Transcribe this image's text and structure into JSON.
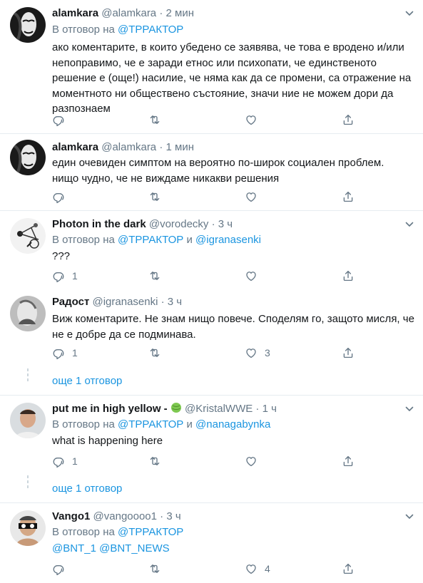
{
  "tweets": [
    {
      "name": "alamkara",
      "handle": "@alamkara",
      "dot": "·",
      "time": "2 мин",
      "reply_prefix": "В отговор на",
      "reply_to_1": "@ТРРАКТОР",
      "body": [
        "ако коментарите, в които убедено се заявява, че това е вродено и/или",
        "непоправимо, че е заради етнос или психопати, че единственото",
        "решение е (още!) насилие, че няма как да се промени, са отражение на",
        "моментното ни обществено състояние, значи ние не можем дори да",
        "разпознаем"
      ],
      "reply_count": "",
      "retweet_count": "",
      "like_count": ""
    },
    {
      "name": "alamkara",
      "handle": "@alamkara",
      "dot": "·",
      "time": "1 мин",
      "body": [
        "един очевиден симптом на вероятно по-широк социален проблем.",
        "нищо чудно, че не виждаме никакви решения"
      ],
      "reply_count": "",
      "retweet_count": "",
      "like_count": ""
    },
    {
      "name": "Photon in the dark",
      "handle": "@vorodecky",
      "dot": "·",
      "time": "3 ч",
      "reply_prefix": "В отговор на",
      "reply_to_1": "@ТРРАКТОР",
      "reply_and": "и",
      "reply_to_2": "@igranasenki",
      "body": [
        "???"
      ],
      "reply_count": "1",
      "retweet_count": "",
      "like_count": ""
    },
    {
      "name": "Радост",
      "handle": "@igranasenki",
      "dot": "·",
      "time": "3 ч",
      "body": [
        "Виж коментарите. Не знам нищо повече. Споделям го, защото мисля, че",
        "не е добре да се подминава."
      ],
      "reply_count": "1",
      "retweet_count": "",
      "like_count": "3",
      "more_replies": "още 1 отговор"
    },
    {
      "name": "put me in high yellow -",
      "handle": "@KristalWWE",
      "dot": "·",
      "time": "1 ч",
      "reply_prefix": "В отговор на",
      "reply_to_1": "@ТРРАКТОР",
      "reply_and": "и",
      "reply_to_2": "@nanagabynka",
      "body": [
        "what is happening here"
      ],
      "reply_count": "1",
      "retweet_count": "",
      "like_count": "",
      "more_replies": "още 1 отговор"
    },
    {
      "name": "Vango1",
      "handle": "@vangoooo1",
      "dot": "·",
      "time": "3 ч",
      "reply_prefix": "В отговор на",
      "reply_to_1": "@ТРРАКТОР",
      "body_mentions": [
        "@BNT_1",
        "@BNT_NEWS"
      ],
      "reply_count": "",
      "retweet_count": "",
      "like_count": "4"
    }
  ],
  "colors": {
    "link": "#1b95e0",
    "muted": "#657786",
    "separator": "#e6ecf0"
  },
  "icons": [
    "caret-down-icon",
    "reply-icon",
    "retweet-icon",
    "like-icon",
    "share-icon",
    "melon-emoji-icon"
  ]
}
